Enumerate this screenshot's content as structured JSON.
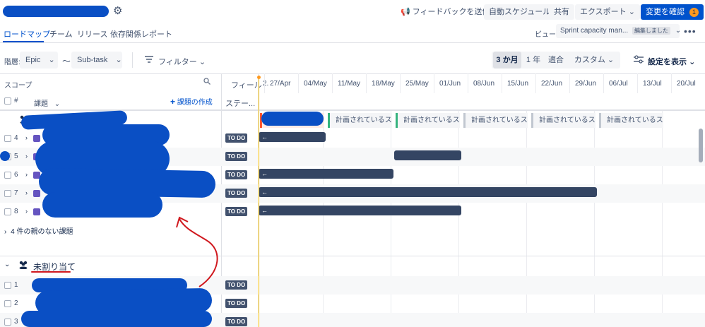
{
  "header": {
    "feedback": "フィードバックを送信",
    "auto_schedule": "自動スケジュール",
    "share": "共有",
    "export": "エクスポート",
    "confirm_changes": "変更を確認",
    "changes_count": "1"
  },
  "tabs": [
    "ロードマップ",
    "チーム",
    "リリース",
    "依存関係レポート"
  ],
  "view": {
    "label": "ビュー:",
    "value": "Sprint capacity man...",
    "edited": "編集しました"
  },
  "toolbar": {
    "hierarchy_label": "階層:",
    "from_level": "Epic",
    "to_level": "Sub-task",
    "filter": "フィルター",
    "ranges": [
      "3 か月",
      "1 年",
      "適合",
      "カスタム"
    ],
    "settings": "設定を表示"
  },
  "scope": {
    "label": "スコープ",
    "hash": "#",
    "issue": "課題",
    "create": "課題の作成",
    "fields": "フィール",
    "status": "ステー..."
  },
  "timeline": {
    "dates": [
      "2.",
      "27/Apr",
      "04/May",
      "11/May",
      "18/May",
      "25/May",
      "01/Jun",
      "08/Jun",
      "15/Jun",
      "22/Jun",
      "29/Jun",
      "06/Jul",
      "13/Jul",
      "20/Jul"
    ],
    "sprint_label": "計画されているス..."
  },
  "rows": [
    {
      "num": "4",
      "status": "TO DO",
      "bar_start": 0,
      "bar_weeks": 2,
      "arrow": true
    },
    {
      "num": "5",
      "status": "TO DO",
      "bar_start": 4,
      "bar_weeks": 2,
      "arrow": false
    },
    {
      "num": "6",
      "status": "TO DO",
      "bar_start": 0,
      "bar_weeks": 4,
      "arrow": true
    },
    {
      "num": "7",
      "status": "TO DO",
      "bar_start": 0,
      "bar_weeks": 10,
      "arrow": true
    },
    {
      "num": "8",
      "status": "TO DO",
      "bar_start": 0,
      "bar_weeks": 6,
      "arrow": true
    }
  ],
  "no_parent": "4 件の親のない課題",
  "unassigned": {
    "label": "未割り当て",
    "rows": [
      {
        "num": "1",
        "status": "TO DO"
      },
      {
        "num": "2",
        "status": "TO DO"
      },
      {
        "num": "3",
        "status": "TO DO"
      }
    ]
  },
  "colors": {
    "primary": "#0052cc",
    "bar": "#344563",
    "todo": "#42526e",
    "sprint_active": "#36b37e"
  }
}
